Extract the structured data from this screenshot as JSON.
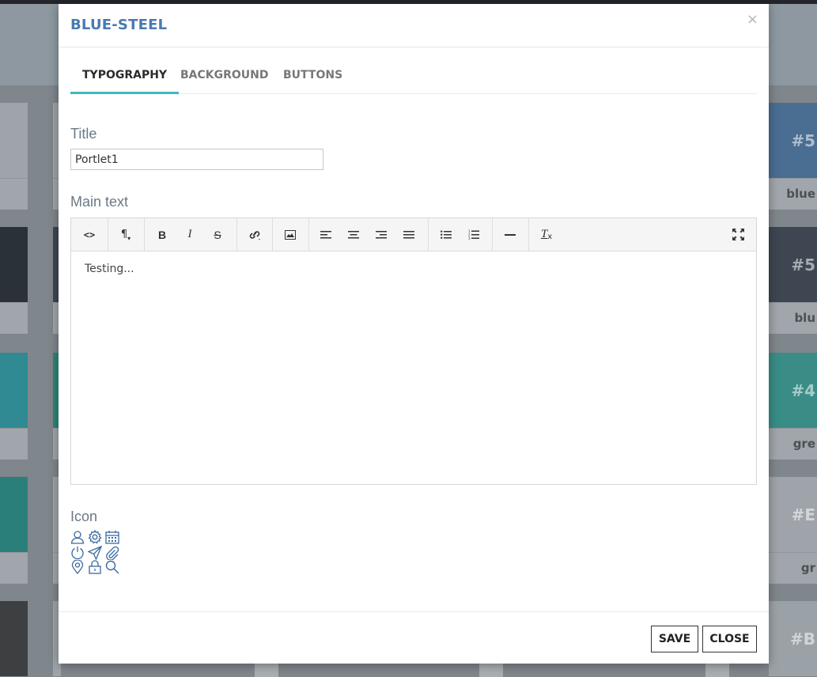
{
  "background": {
    "tiles": [
      {
        "hex": "#5",
        "name": "blue"
      },
      {
        "hex": "#5",
        "name": "blu"
      },
      {
        "hex": "#4",
        "name": "gre"
      },
      {
        "hex": "#E",
        "name": "gr"
      },
      {
        "hex": "#B",
        "name": ""
      }
    ],
    "colors": {
      "row1": "#4a6d92",
      "row2": "#3d4651",
      "row3": "#3a8c92",
      "row4": "#2f7f7a",
      "row5": "#4a4d50"
    }
  },
  "modal": {
    "title": "BLUE-STEEL",
    "close_glyph": "×",
    "tabs": [
      {
        "label": "TYPOGRAPHY",
        "active": true
      },
      {
        "label": "BACKGROUND",
        "active": false
      },
      {
        "label": "BUTTONS",
        "active": false
      }
    ],
    "title_field": {
      "label": "Title",
      "value": "Portlet1"
    },
    "main_text": {
      "label": "Main text",
      "content": "Testing...",
      "toolbar": [
        {
          "name": "code-view-icon",
          "glyph": "<>"
        },
        {
          "name": "paragraph-style-icon",
          "glyph": "¶"
        },
        {
          "name": "bold-icon",
          "glyph": "B"
        },
        {
          "name": "italic-icon",
          "glyph": "I"
        },
        {
          "name": "strikethrough-icon",
          "glyph": "S"
        },
        {
          "name": "link-icon",
          "glyph": "link"
        },
        {
          "name": "image-icon",
          "glyph": "image"
        },
        {
          "name": "align-left-icon",
          "glyph": "align-left"
        },
        {
          "name": "align-center-icon",
          "glyph": "align-center"
        },
        {
          "name": "align-right-icon",
          "glyph": "align-right"
        },
        {
          "name": "align-justify-icon",
          "glyph": "align-justify"
        },
        {
          "name": "bullet-list-icon",
          "glyph": "ul"
        },
        {
          "name": "numbered-list-icon",
          "glyph": "ol"
        },
        {
          "name": "horizontal-rule-icon",
          "glyph": "hr"
        },
        {
          "name": "clear-format-icon",
          "glyph": "Tx"
        },
        {
          "name": "fullscreen-icon",
          "glyph": "fullscreen"
        }
      ]
    },
    "icon_field": {
      "label": "Icon",
      "icons": [
        "user-icon",
        "gear-icon",
        "calendar-icon",
        "power-icon",
        "send-icon",
        "paperclip-icon",
        "map-pin-icon",
        "lock-icon",
        "search-icon"
      ]
    },
    "footer": {
      "save_label": "SAVE",
      "close_label": "CLOSE"
    },
    "accent_color": "#3fb9c4",
    "title_color": "#4a7ab2"
  }
}
